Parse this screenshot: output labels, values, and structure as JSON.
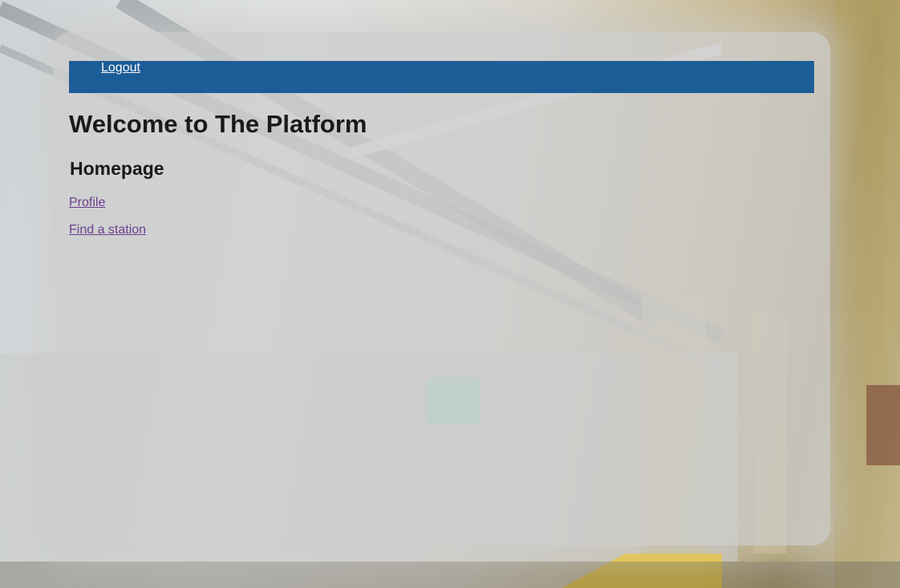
{
  "background": {
    "description_icon": "subway-platform-photo"
  },
  "navbar": {
    "logout_label": "Logout",
    "color": "#0e5493"
  },
  "main": {
    "title": "Welcome to The Platform",
    "subtitle": "Homepage",
    "links": [
      {
        "label": "Profile"
      },
      {
        "label": "Find a station"
      }
    ],
    "link_color": "#6b3f8f"
  }
}
